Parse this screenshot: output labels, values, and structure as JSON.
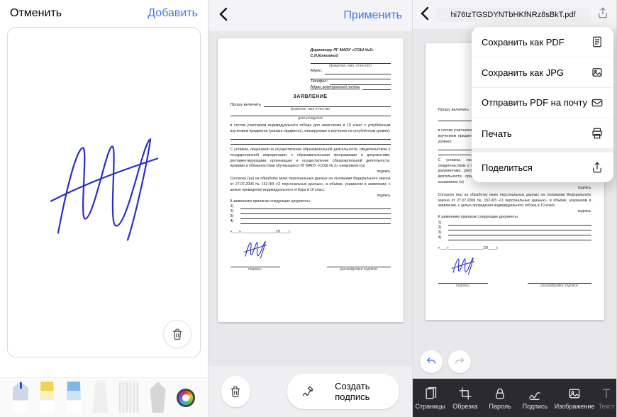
{
  "panel1": {
    "cancel_label": "Отменить",
    "add_label": "Добавить",
    "trash_name": "trash-icon",
    "tools": [
      "pen-blue",
      "highlighter-yellow",
      "highlighter-blue",
      "eraser",
      "ruler",
      "cutter",
      "color-picker"
    ]
  },
  "panel2": {
    "apply_label": "Применить",
    "create_sig_label": "Создать подпись",
    "doc": {
      "recipient_lines": [
        "Директору    ЛГ    МАОУ    «СОШ    №3»",
        "С.Н.Котовной"
      ],
      "field_labels": [
        "(фамилия, имя, отчество)",
        "Адрес:",
        "Телефон:",
        "Адрес электронной почты"
      ],
      "title": "ЗАЯВЛЕНИЕ",
      "include": "Прошу включить",
      "include_sub": "фамилия, имя отчество",
      "dob_sub": "дата рождения",
      "para1": "в состав участников индивидуального отбора для зачисления в 10 класс с углублённым изучением предметов (указать предметы), планируемые к изучению на углублённом уровне):",
      "para2": "С уставом, лицензией на осуществление образовательной деятельности, свидетельством о государственной аккредитации, с образовательными программами и документами, регламентирующими организацию и осуществление образовательной деятельности, правами и обязанностями обучающихся ЛГ МАОУ «СОШ № 3» ознакомлен (а)",
      "para2_sig": "подпись",
      "para3": "Согласен (на) на обработку моих персональных данных на основании Федерального закона от 27.07.2006 № 152-ФЗ «О персональных данных», в объёме, указанном в заявлении, с целью проведения индивидуального отбора в 10 класс",
      "para3_sig": "подпись",
      "attach": "К заявлению прилагаю следующие документы:",
      "list_nums": [
        "1)",
        "2)",
        "3)",
        "4)"
      ],
      "date_tpl": "«___»________________20____г.",
      "sig_left_label": "подпись",
      "sig_right_label": "расшифровка подписи"
    }
  },
  "panel3": {
    "filename": "hi76tzTGSDYNTbHKfNRz8sBkT.pdf",
    "menu": {
      "save_pdf": "Сохранить как PDF",
      "save_jpg": "Сохранить как JPG",
      "send_mail": "Отправить PDF на почту",
      "print": "Печать",
      "share": "Поделиться"
    },
    "toolbar": {
      "pages": "Страницы",
      "crop": "Обрезка",
      "password": "Пароль",
      "sign": "Подпись",
      "image": "Изображение",
      "text": "Текст"
    }
  }
}
